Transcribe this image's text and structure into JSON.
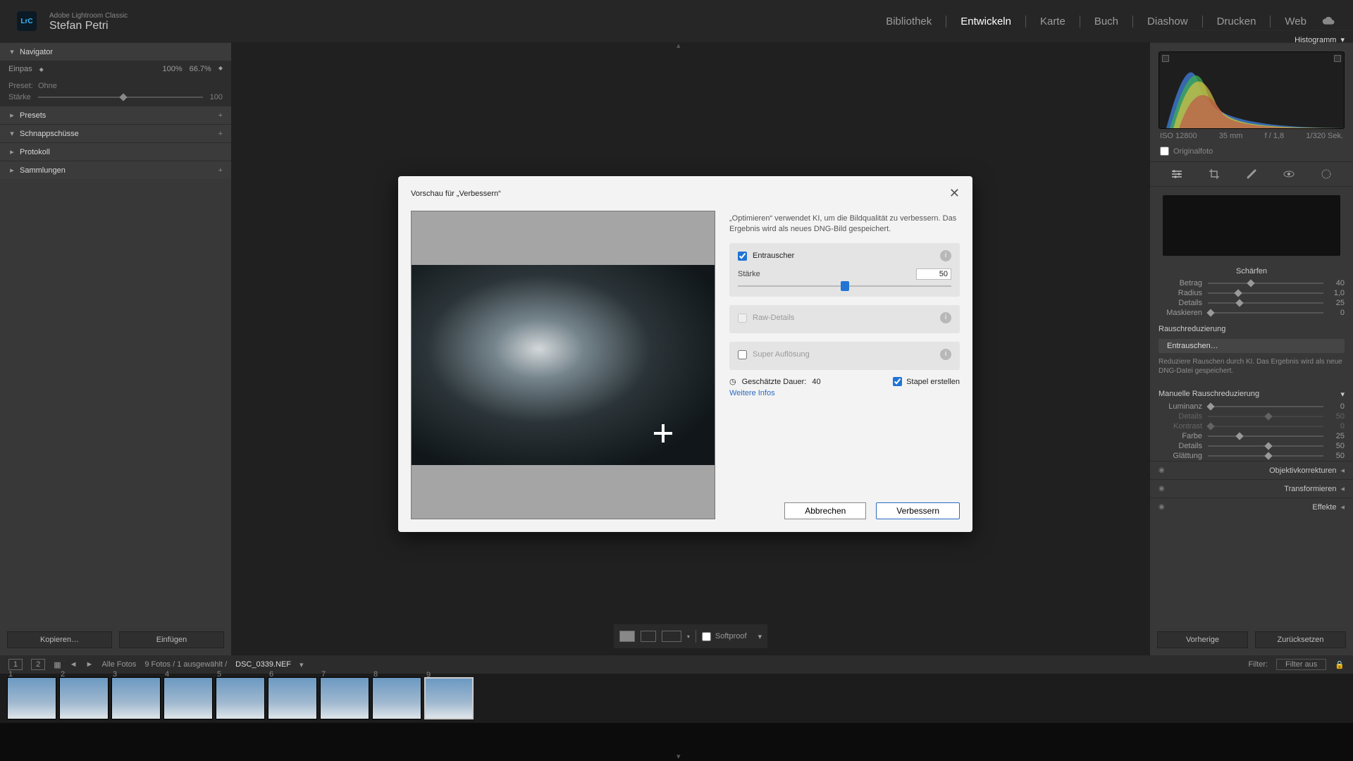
{
  "header": {
    "app": "Adobe Lightroom Classic",
    "user": "Stefan Petri",
    "modules": [
      "Bibliothek",
      "Entwickeln",
      "Karte",
      "Buch",
      "Diashow",
      "Drucken",
      "Web"
    ],
    "active_module": "Entwickeln"
  },
  "left": {
    "navigator": "Navigator",
    "fit": "Einpas",
    "z100": "100%",
    "z66": "66.7%",
    "preset_label": "Preset:",
    "preset_value": "Ohne",
    "strength_label": "Stärke",
    "strength_value": "100",
    "presets": "Presets",
    "snapshots": "Schnappschüsse",
    "history": "Protokoll",
    "collections": "Sammlungen",
    "copy": "Kopieren…",
    "paste": "Einfügen"
  },
  "right": {
    "histogram": "Histogramm",
    "iso": "ISO 12800",
    "focal": "35 mm",
    "aperture": "f / 1,8",
    "shutter": "1/320 Sek.",
    "originalfoto": "Originalfoto",
    "sharpen": "Schärfen",
    "sharpen_rows": [
      {
        "label": "Betrag",
        "val": "40",
        "pos": 35
      },
      {
        "label": "Radius",
        "val": "1,0",
        "pos": 24
      },
      {
        "label": "Details",
        "val": "25",
        "pos": 25
      },
      {
        "label": "Maskieren",
        "val": "0",
        "pos": 0
      }
    ],
    "noise": "Rauschreduzierung",
    "denoise_btn": "Entrauschen…",
    "denoise_desc": "Reduziere Rauschen durch KI. Das Ergebnis wird als neue DNG-Datei gespeichert.",
    "manual_noise": "Manuelle Rauschreduzierung",
    "noise_rows": [
      {
        "label": "Luminanz",
        "val": "0",
        "pos": 0,
        "dis": false
      },
      {
        "label": "Details",
        "val": "50",
        "pos": 50,
        "dis": true
      },
      {
        "label": "Kontrast",
        "val": "0",
        "pos": 0,
        "dis": true
      },
      {
        "label": "Farbe",
        "val": "25",
        "pos": 25,
        "dis": false
      },
      {
        "label": "Details",
        "val": "50",
        "pos": 50,
        "dis": false
      },
      {
        "label": "Glättung",
        "val": "50",
        "pos": 50,
        "dis": false
      }
    ],
    "lens": "Objektivkorrekturen",
    "transform": "Transformieren",
    "effects": "Effekte",
    "prev": "Vorherige",
    "reset": "Zurücksetzen"
  },
  "toolbar": {
    "softproof": "Softproof"
  },
  "status": {
    "count": "Alle Fotos",
    "selection": "9 Fotos / 1 ausgewählt /",
    "filename": "DSC_0339.NEF",
    "filter_label": "Filter:",
    "filter_value": "Filter aus"
  },
  "thumb_count": 9,
  "dialog": {
    "title": "Vorschau für „Verbessern“",
    "desc": "„Optimieren“ verwendet KI, um die Bildqualität zu verbessern. Das Ergebnis wird als neues DNG-Bild gespeichert.",
    "denoise": "Entrauscher",
    "strength_label": "Stärke",
    "strength_value": "50",
    "raw": "Raw-Details",
    "super": "Super Auflösung",
    "duration_label": "Geschätzte Dauer:",
    "duration_value": "40",
    "stack": "Stapel erstellen",
    "moreinfo": "Weitere Infos",
    "cancel": "Abbrechen",
    "enhance": "Verbessern"
  }
}
